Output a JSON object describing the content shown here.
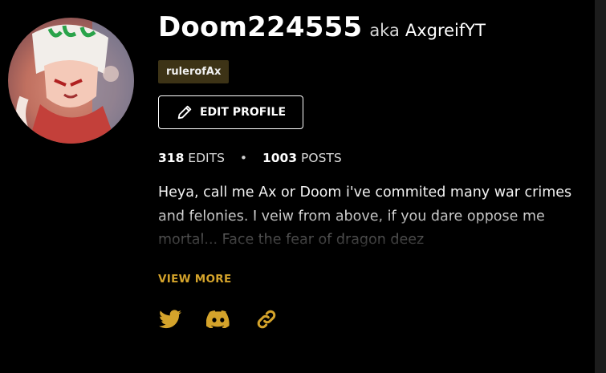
{
  "profile": {
    "username": "Doom224555",
    "aka": "aka",
    "alias": "AxgreifYT",
    "badge": "rulerofAx"
  },
  "actions": {
    "edit_label": "EDIT PROFILE"
  },
  "stats": {
    "edits_count": "318",
    "edits_label": "EDITS",
    "separator": "•",
    "posts_count": "1003",
    "posts_label": "POSTS"
  },
  "bio": {
    "text": "Heya, call me Ax or Doom i've commited many war crimes and felonies. I veiw from above, if you dare oppose me mortal... Face the fear of dragon deez",
    "view_more_label": "VIEW MORE"
  },
  "socials": [
    {
      "icon": "twitter-icon"
    },
    {
      "icon": "discord-icon"
    },
    {
      "icon": "link-icon"
    }
  ],
  "colors": {
    "background": "#000000",
    "accent": "#d4a32b",
    "badge_bg": "#3d3316"
  }
}
